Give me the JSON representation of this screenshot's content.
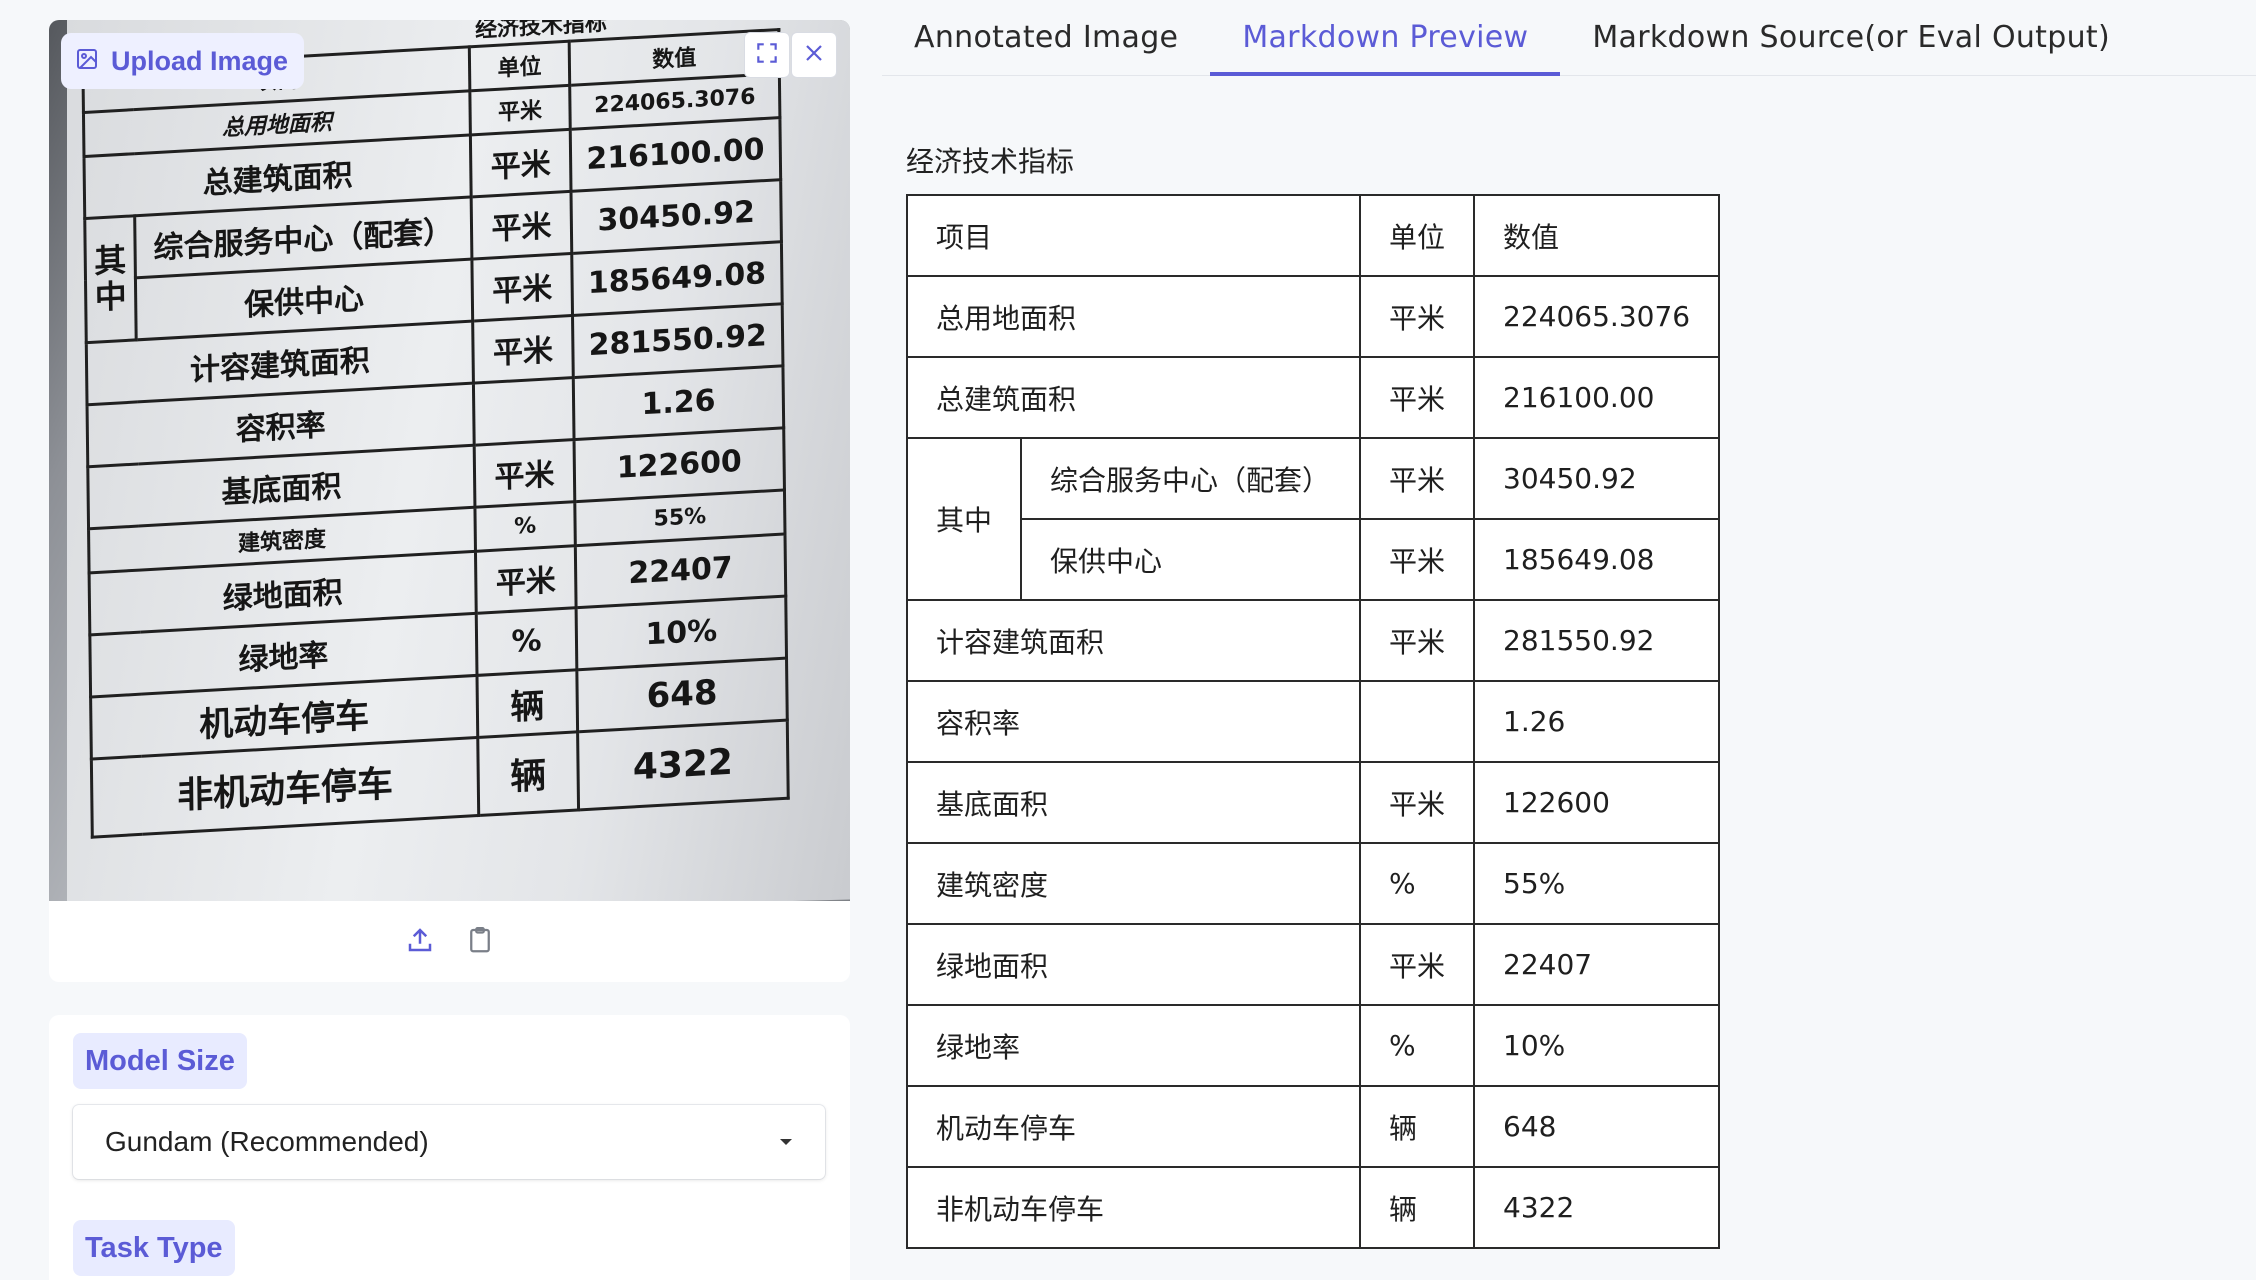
{
  "upload": {
    "label": "Upload Image"
  },
  "photo": {
    "title": "经济技术指标",
    "header": {
      "item": "项目",
      "unit": "单位",
      "value": "数值"
    },
    "group": "其中",
    "rows": [
      {
        "item": "总用地面积",
        "unit": "平米",
        "value": "224065.3076"
      },
      {
        "item": "总建筑面积",
        "unit": "平米",
        "value": "216100.00"
      },
      {
        "item": "综合服务中心（配套）",
        "unit": "平米",
        "value": "30450.92"
      },
      {
        "item": "保供中心",
        "unit": "平米",
        "value": "185649.08"
      },
      {
        "item": "计容建筑面积",
        "unit": "平米",
        "value": "281550.92"
      },
      {
        "item": "容积率",
        "unit": "",
        "value": "1.26"
      },
      {
        "item": "基底面积",
        "unit": "平米",
        "value": "122600"
      },
      {
        "item": "建筑密度",
        "unit": "%",
        "value": "55%"
      },
      {
        "item": "绿地面积",
        "unit": "平米",
        "value": "22407"
      },
      {
        "item": "绿地率",
        "unit": "%",
        "value": "10%"
      },
      {
        "item": "机动车停车",
        "unit": "辆",
        "value": "648"
      },
      {
        "item": "非机动车停车",
        "unit": "辆",
        "value": "4322"
      }
    ]
  },
  "options": {
    "model_size_label": "Model Size",
    "model_size_value": "Gundam (Recommended)",
    "task_type_label": "Task Type"
  },
  "tabs": [
    {
      "label": "Annotated Image"
    },
    {
      "label": "Markdown Preview"
    },
    {
      "label": "Markdown Source(or Eval Output)"
    }
  ],
  "preview": {
    "title": "经济技术指标",
    "header": {
      "item": "项目",
      "unit": "单位",
      "value": "数值"
    },
    "group": "其中",
    "rows": [
      {
        "item": "总用地面积",
        "unit": "平米",
        "value": "224065.3076"
      },
      {
        "item": "总建筑面积",
        "unit": "平米",
        "value": "216100.00"
      },
      {
        "item": "综合服务中心（配套）",
        "unit": "平米",
        "value": "30450.92"
      },
      {
        "item": "保供中心",
        "unit": "平米",
        "value": "185649.08"
      },
      {
        "item": "计容建筑面积",
        "unit": "平米",
        "value": "281550.92"
      },
      {
        "item": "容积率",
        "unit": "",
        "value": "1.26"
      },
      {
        "item": "基底面积",
        "unit": "平米",
        "value": "122600"
      },
      {
        "item": "建筑密度",
        "unit": "%",
        "value": "55%"
      },
      {
        "item": "绿地面积",
        "unit": "平米",
        "value": "22407"
      },
      {
        "item": "绿地率",
        "unit": "%",
        "value": "10%"
      },
      {
        "item": "机动车停车",
        "unit": "辆",
        "value": "648"
      },
      {
        "item": "非机动车停车",
        "unit": "辆",
        "value": "4322"
      }
    ]
  },
  "colors": {
    "accent": "#5b5bd6",
    "chip_bg": "#e8ebff",
    "page_bg": "#f6f8fa"
  }
}
